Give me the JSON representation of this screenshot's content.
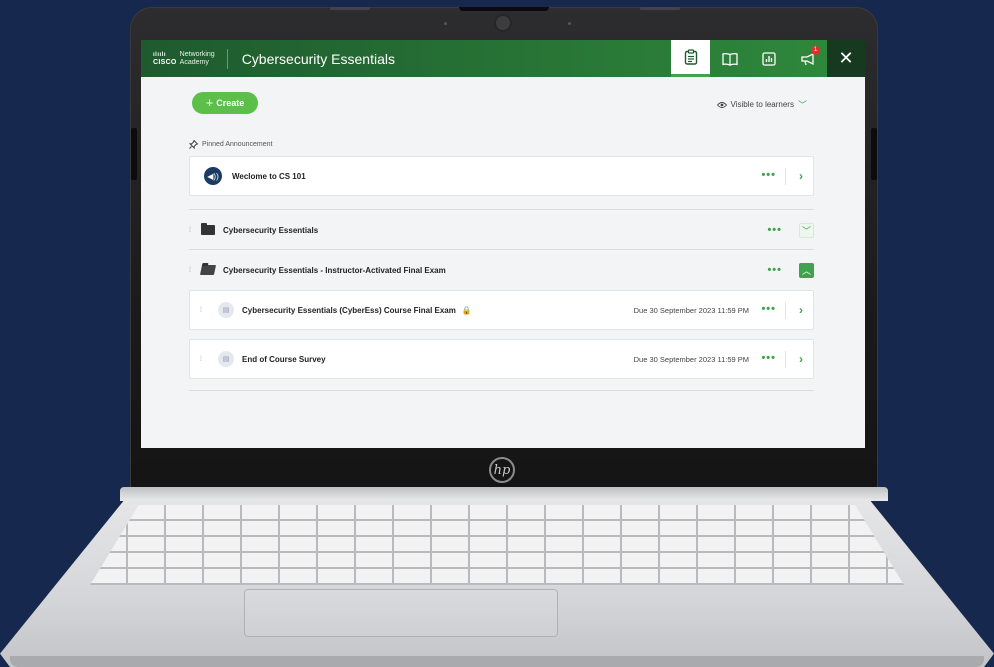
{
  "device": {
    "logo_text": "hp"
  },
  "header": {
    "brand_top": "ılıılı",
    "brand_cisco": "CISCO",
    "brand_networking": "Networking",
    "brand_academy": "Academy",
    "course_title": "Cybersecurity Essentials",
    "badge_count": "1",
    "close_symbol": "✕"
  },
  "toolbar": {
    "create_label": "Create",
    "visibility_label": "Visible to learners"
  },
  "pinned": {
    "label": "Pinned Announcement",
    "announcement_title": "Weclome to CS 101"
  },
  "modules": [
    {
      "title": "Cybersecurity Essentials",
      "expanded": false
    },
    {
      "title": "Cybersecurity Essentials - Instructor-Activated Final Exam",
      "expanded": true,
      "items": [
        {
          "title": "Cybersecurity Essentials (CyberEss) Course Final Exam",
          "due": "Due 30 September 2023 11:59 PM",
          "locked": true
        },
        {
          "title": "End of Course Survey",
          "due": "Due 30 September 2023 11:59 PM",
          "locked": false
        }
      ]
    }
  ],
  "colors": {
    "accent": "#3fa34d",
    "header_start": "#1e5a2e",
    "header_end": "#2f8a3c",
    "create_button": "#5cbf4a",
    "background": "#16284d",
    "lock": "#e0312d"
  },
  "icons": {
    "assignments": "clipboard-icon",
    "gradebook": "book-icon",
    "reports": "chart-icon",
    "announcements": "megaphone-icon",
    "close": "close-icon"
  }
}
